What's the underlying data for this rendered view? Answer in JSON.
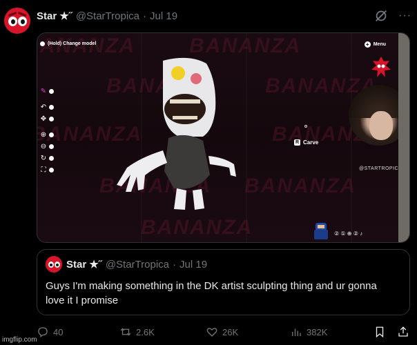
{
  "tweet": {
    "author_name": "Star",
    "author_badge": "★˝",
    "handle": "@StarTropica",
    "separator": "·",
    "date": "Jul 19",
    "more": "···"
  },
  "media": {
    "hud_top_left": "(Hold) Change model",
    "hud_menu": "Menu",
    "carve_key": "R",
    "carve_label": "Carve",
    "cam_label": "@STARTROPICA",
    "background_word": "BANANZA",
    "hud_bottom": "② ① ⊕ ② ♪"
  },
  "quote": {
    "author_name": "Star",
    "author_badge": "★˝",
    "handle": "@StarTropica",
    "separator": "·",
    "date": "Jul 19",
    "text": "Guys I'm making something in the DK artist sculpting thing and ur gonna love it I promise"
  },
  "actions": {
    "replies": "40",
    "reposts": "2.6K",
    "likes": "26K",
    "views": "382K"
  },
  "watermark": "imgflip.com",
  "colors": {
    "background": "#000000",
    "text": "#e7e9ea",
    "muted": "#71767b",
    "border": "#2f3336",
    "avatar": "#d6152b"
  },
  "icons": [
    "grok-icon",
    "more-icon",
    "reply-icon",
    "repost-icon",
    "like-icon",
    "views-icon",
    "bookmark-icon",
    "share-icon"
  ]
}
